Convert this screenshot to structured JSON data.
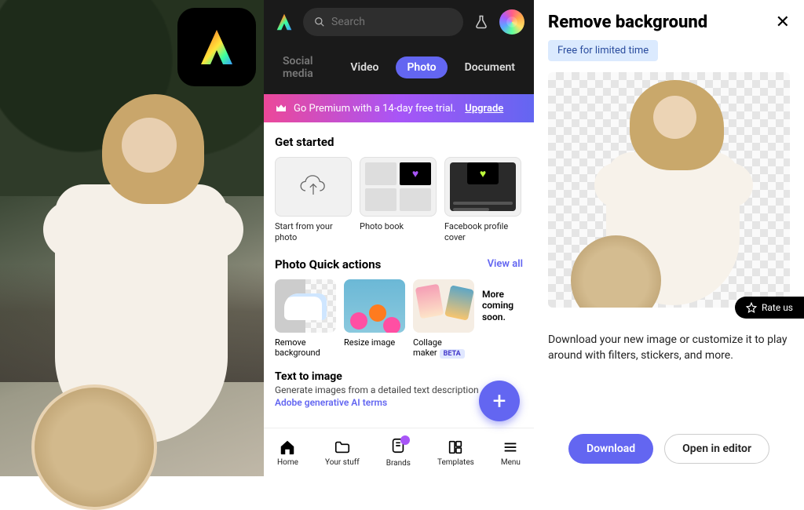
{
  "panel2": {
    "search_placeholder": "Search",
    "tabs": {
      "social": "Social media",
      "video": "Video",
      "photo": "Photo",
      "document": "Document"
    },
    "premium": {
      "text": "Go Premium with a 14-day free trial.",
      "cta": "Upgrade"
    },
    "get_started": {
      "title": "Get started",
      "cards": {
        "upload": "Start from your photo",
        "book": "Photo book",
        "fb": "Facebook profile cover"
      }
    },
    "quick": {
      "title": "Photo Quick actions",
      "view_all": "View all",
      "cards": {
        "remove": "Remove background",
        "resize": "Resize image",
        "collage": "Collage maker",
        "collage_badge": "BETA",
        "more": "More coming soon."
      }
    },
    "t2i": {
      "title": "Text to image",
      "sub": "Generate images from a detailed text description",
      "terms": "Adobe generative AI terms"
    },
    "nav": {
      "home": "Home",
      "stuff": "Your stuff",
      "brands": "Brands",
      "templates": "Templates",
      "menu": "Menu"
    }
  },
  "panel3": {
    "title": "Remove background",
    "badge": "Free for limited time",
    "rate": "Rate us",
    "desc": "Download your new image or customize it to play around with filters, stickers, and more.",
    "download": "Download",
    "open": "Open in editor"
  }
}
